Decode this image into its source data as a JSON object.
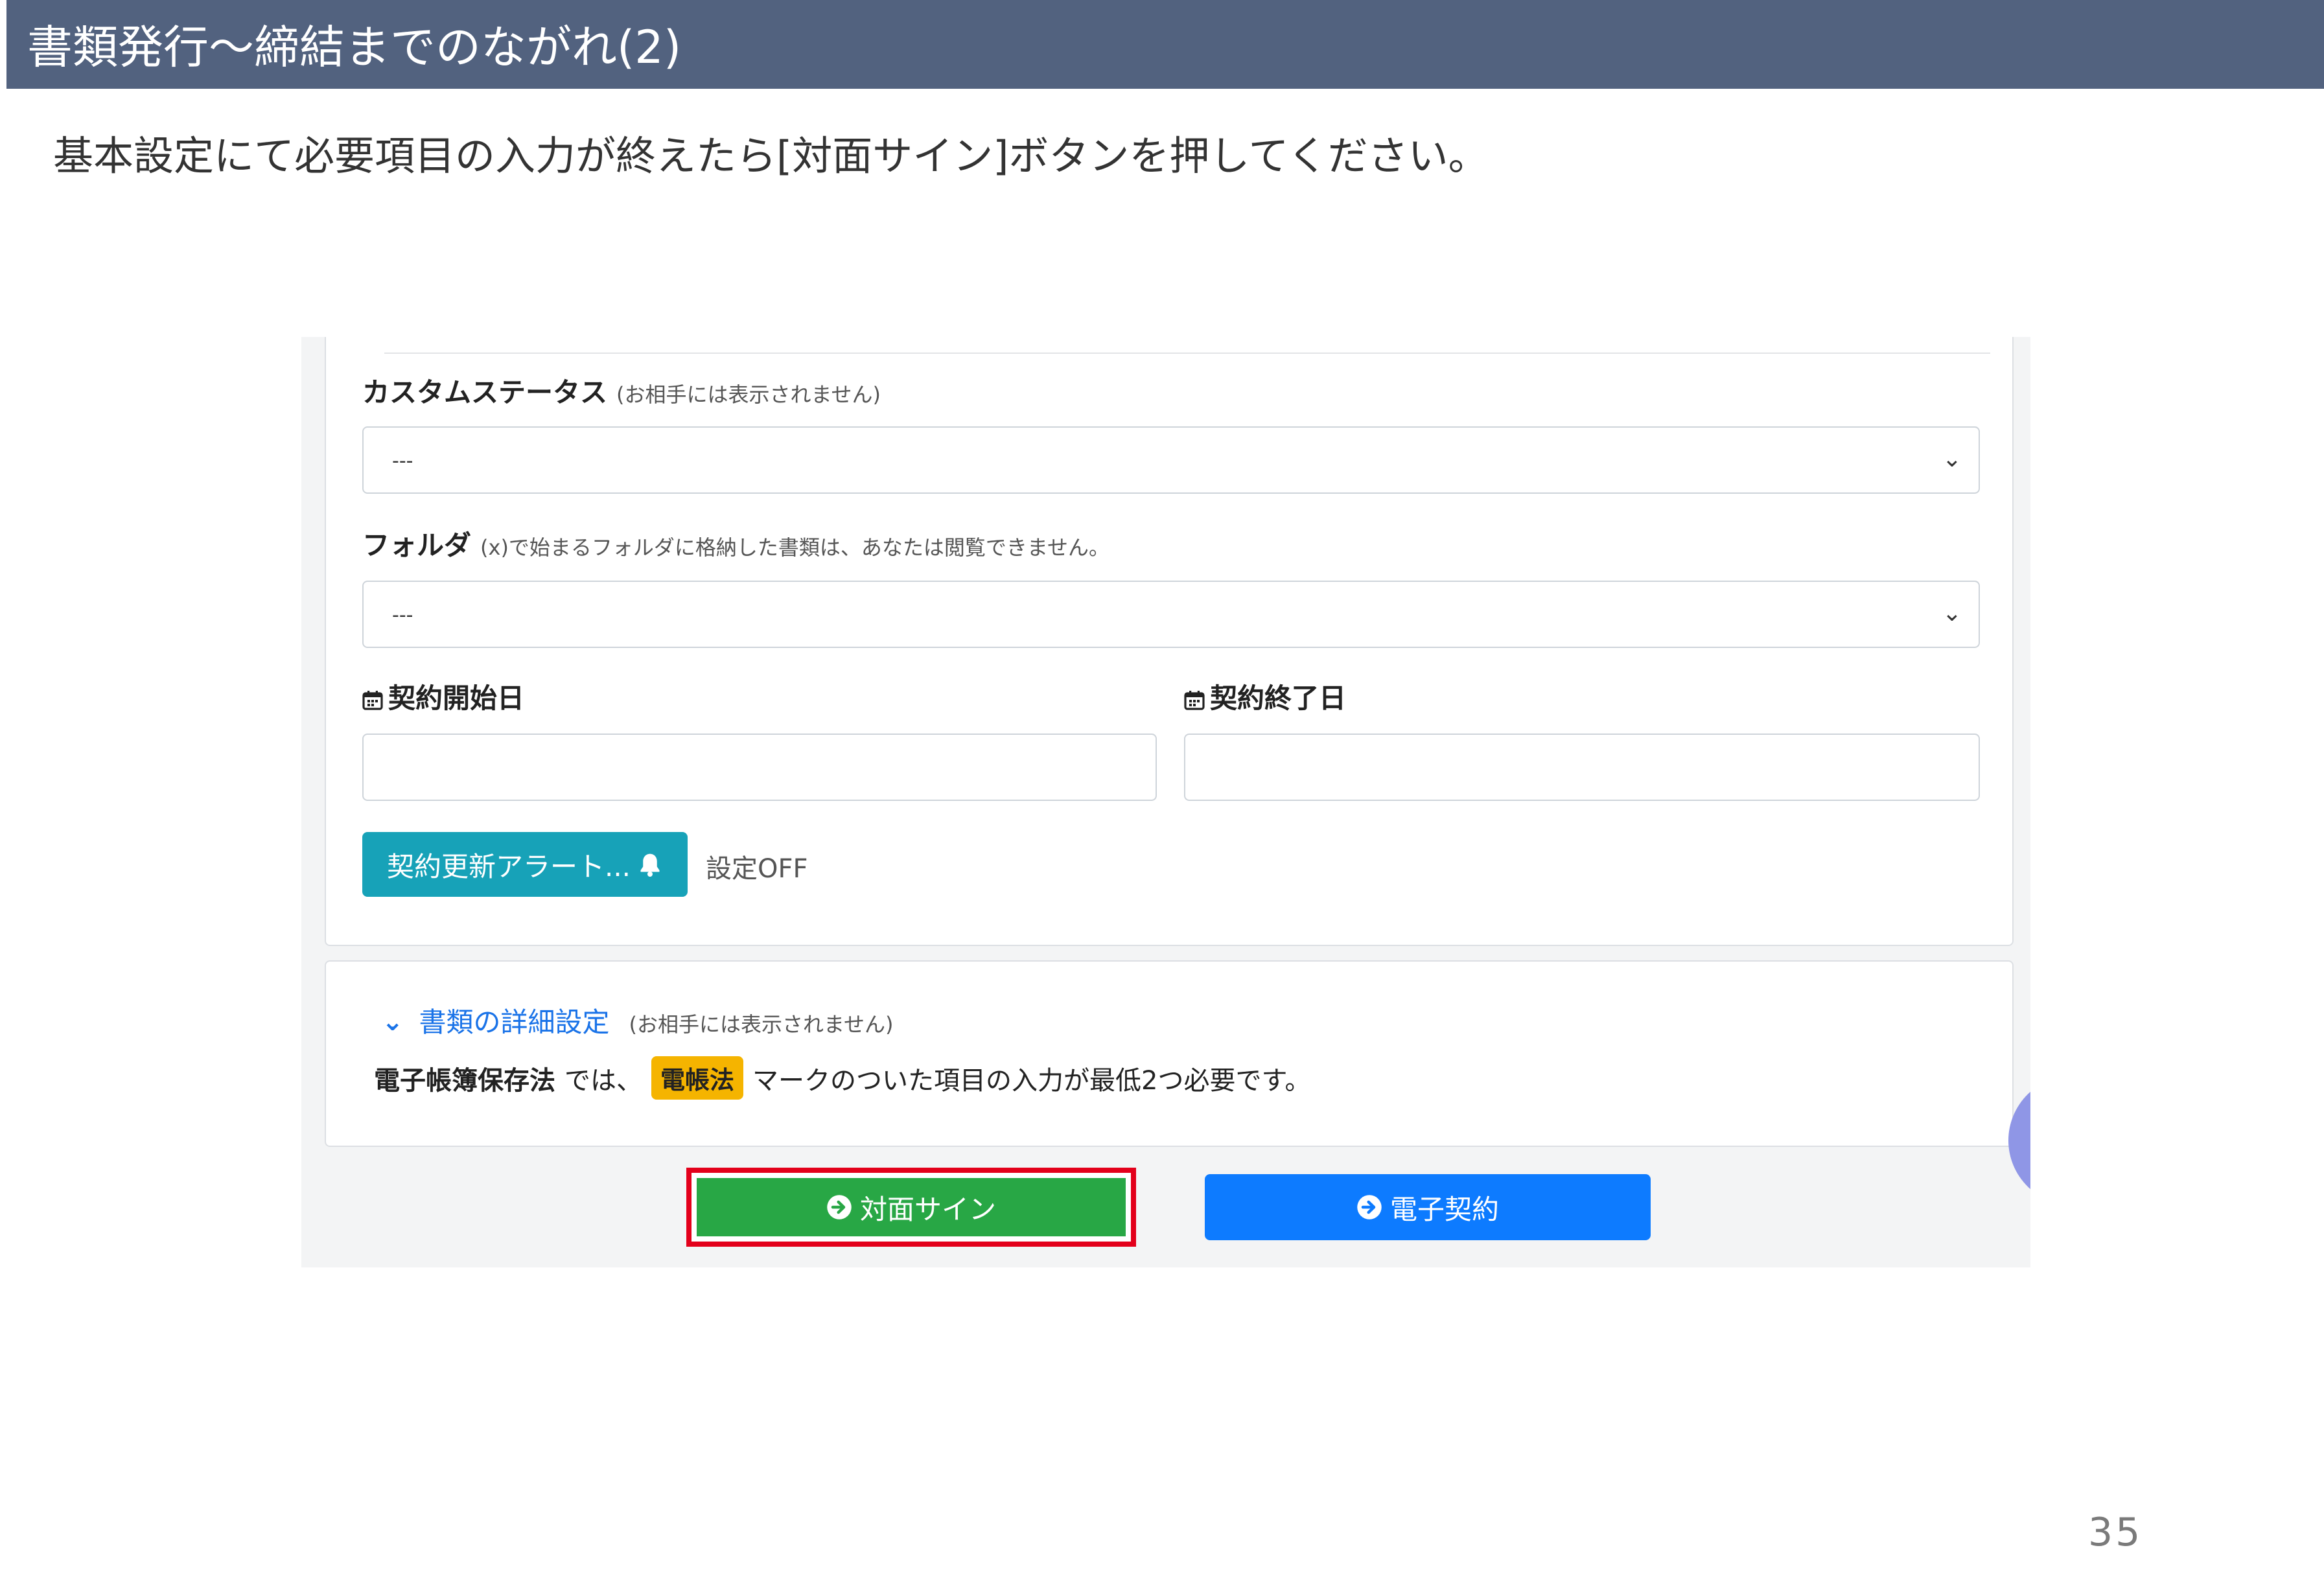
{
  "slide": {
    "title": "書類発行～締結までのながれ(2)",
    "instruction": "基本設定にて必要項目の入力が終えたら[対面サイン]ボタンを押してください。",
    "page_number": "35"
  },
  "form": {
    "custom_status": {
      "label": "カスタムステータス",
      "note": "(お相手には表示されません)",
      "value": "---"
    },
    "folder": {
      "label": "フォルダ",
      "note": "(x)で始まるフォルダに格納した書類は、あなたは閲覧できません。",
      "value": "---"
    },
    "start_date": {
      "label": "契約開始日",
      "value": ""
    },
    "end_date": {
      "label": "契約終了日",
      "value": ""
    },
    "alert_button": {
      "label": "契約更新アラート..."
    },
    "alert_status": "設定OFF"
  },
  "details": {
    "toggle_label": "書類の詳細設定",
    "toggle_note": "(お相手には表示されません)",
    "law_name": "電子帳簿保存法",
    "text_mid": "では、",
    "badge": "電帳法",
    "text_end": "マークのついた項目の入力が最低2つ必要です。"
  },
  "actions": {
    "face_sign": "対面サイン",
    "e_contract": "電子契約"
  },
  "colors": {
    "header_bg": "#52627f",
    "face_sign_bg": "#28a745",
    "face_sign_highlight": "#e3001b",
    "e_contract_bg": "#0d7bff",
    "alert_button_bg": "#17a2b8",
    "badge_bg": "#f5b400",
    "link": "#1a73e8"
  },
  "icons": {
    "date": "calendar-icon",
    "alert": "bell-icon",
    "action": "arrow-circle-right-icon",
    "toggle": "chevron-down-icon"
  }
}
